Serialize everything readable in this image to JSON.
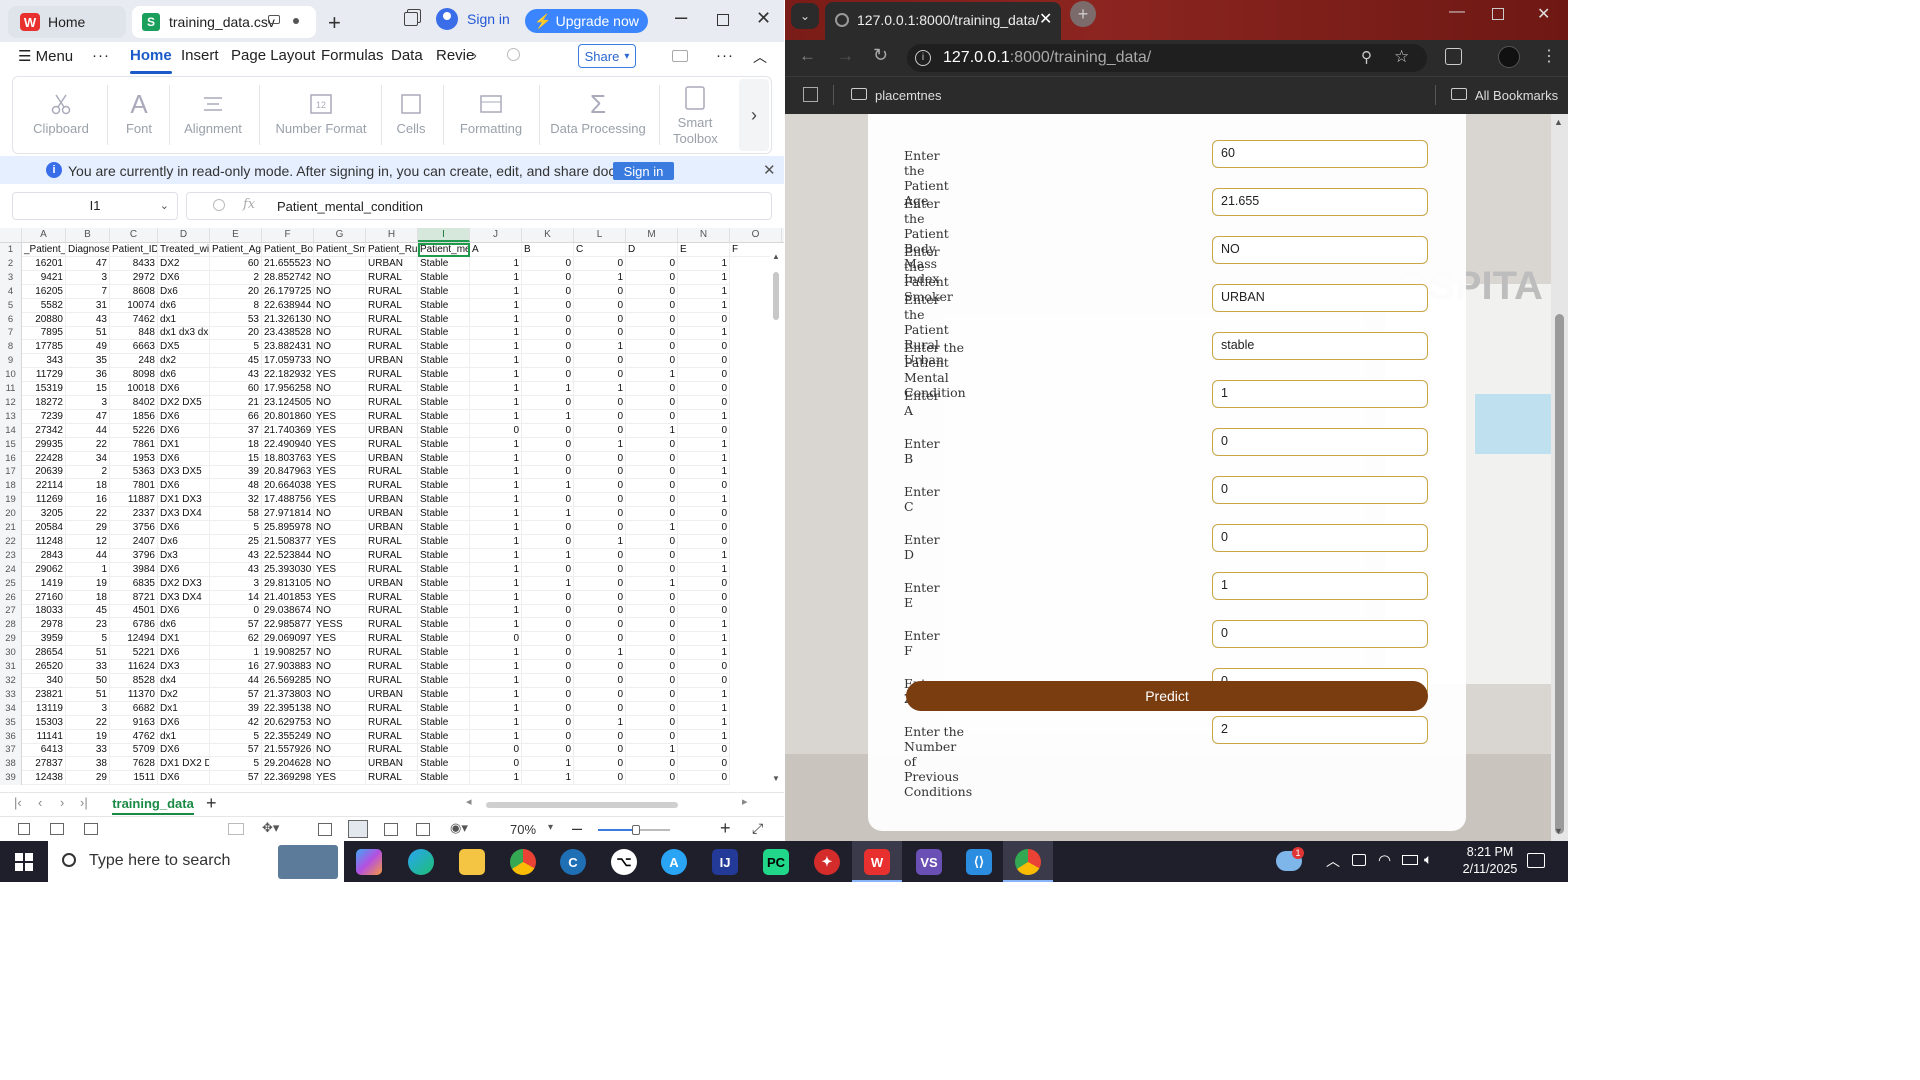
{
  "wps": {
    "home_tab": "Home",
    "file_tab": "training_data.csv",
    "sign_in": "Sign in",
    "upgrade": "Upgrade now",
    "menu": [
      "Menu",
      "Home",
      "Insert",
      "Page Layout",
      "Formulas",
      "Data",
      "Revie"
    ],
    "share": "Share",
    "ribbon": [
      "Clipboard",
      "Font",
      "Alignment",
      "Number Format",
      "Cells",
      "Formatting",
      "Data Processing",
      "Smart Toolbox"
    ],
    "banner_text": "You are currently in read-only mode. After signing in, you can create, edit, and share documents.",
    "banner_signin": "Sign in",
    "name_box": "I1",
    "formula_fx": "fx",
    "formula_value": "Patient_mental_condition",
    "columns": [
      "A",
      "B",
      "C",
      "D",
      "E",
      "F",
      "G",
      "H",
      "I",
      "J",
      "K",
      "L",
      "M",
      "N",
      "O"
    ],
    "header_row": [
      "_Patient_",
      "Diagnosed_",
      "Patient_ID",
      "Treated_wi",
      "Patient_Ag",
      "Patient_Bo",
      "Patient_Sm",
      "Patient_Ru",
      "Patient_me",
      "A",
      "B",
      "C",
      "D",
      "E",
      "F"
    ],
    "rows": [
      [
        "16201",
        "47",
        "8433",
        "DX2",
        "60",
        "21.655523",
        "NO",
        "URBAN",
        "Stable",
        "1",
        "0",
        "0",
        "0",
        "1"
      ],
      [
        "9421",
        "3",
        "2972",
        "DX6",
        "2",
        "28.852742",
        "NO",
        "RURAL",
        "Stable",
        "1",
        "0",
        "1",
        "0",
        "1"
      ],
      [
        "16205",
        "7",
        "8608",
        "Dx6",
        "20",
        "26.179725",
        "NO",
        "RURAL",
        "Stable",
        "1",
        "0",
        "0",
        "0",
        "1"
      ],
      [
        "5582",
        "31",
        "10074",
        "dx6",
        "8",
        "22.638944",
        "NO",
        "RURAL",
        "Stable",
        "1",
        "0",
        "0",
        "0",
        "1"
      ],
      [
        "20880",
        "43",
        "7462",
        "dx1",
        "53",
        "21.326130",
        "NO",
        "RURAL",
        "Stable",
        "1",
        "0",
        "0",
        "0",
        "0"
      ],
      [
        "7895",
        "51",
        "848",
        "dx1 dx3 dx",
        "20",
        "23.438528",
        "NO",
        "RURAL",
        "Stable",
        "1",
        "0",
        "0",
        "0",
        "1"
      ],
      [
        "17785",
        "49",
        "6663",
        "DX5",
        "5",
        "23.882431",
        "NO",
        "RURAL",
        "Stable",
        "1",
        "0",
        "1",
        "0",
        "0"
      ],
      [
        "343",
        "35",
        "248",
        "dx2",
        "45",
        "17.059733",
        "NO",
        "URBAN",
        "Stable",
        "1",
        "0",
        "0",
        "0",
        "0"
      ],
      [
        "11729",
        "36",
        "8098",
        "dx6",
        "43",
        "22.182932",
        "YES",
        "RURAL",
        "Stable",
        "1",
        "0",
        "0",
        "1",
        "0"
      ],
      [
        "15319",
        "15",
        "10018",
        "DX6",
        "60",
        "17.956258",
        "NO",
        "RURAL",
        "Stable",
        "1",
        "1",
        "1",
        "0",
        "0"
      ],
      [
        "18272",
        "3",
        "8402",
        "DX2 DX5",
        "21",
        "23.124505",
        "NO",
        "RURAL",
        "Stable",
        "1",
        "0",
        "0",
        "0",
        "0"
      ],
      [
        "7239",
        "47",
        "1856",
        "DX6",
        "66",
        "20.801860",
        "YES",
        "RURAL",
        "Stable",
        "1",
        "1",
        "0",
        "0",
        "1"
      ],
      [
        "27342",
        "44",
        "5226",
        "DX6",
        "37",
        "21.740369",
        "YES",
        "URBAN",
        "Stable",
        "0",
        "0",
        "0",
        "1",
        "0"
      ],
      [
        "29935",
        "22",
        "7861",
        "DX1",
        "18",
        "22.490940",
        "YES",
        "RURAL",
        "Stable",
        "1",
        "0",
        "1",
        "0",
        "1"
      ],
      [
        "22428",
        "34",
        "1953",
        "DX6",
        "15",
        "18.803763",
        "YES",
        "URBAN",
        "Stable",
        "1",
        "0",
        "0",
        "0",
        "1"
      ],
      [
        "20639",
        "2",
        "5363",
        "DX3 DX5",
        "39",
        "20.847963",
        "YES",
        "RURAL",
        "Stable",
        "1",
        "0",
        "0",
        "0",
        "1"
      ],
      [
        "22114",
        "18",
        "7801",
        "DX6",
        "48",
        "20.664038",
        "YES",
        "RURAL",
        "Stable",
        "1",
        "1",
        "0",
        "0",
        "0"
      ],
      [
        "11269",
        "16",
        "11887",
        "DX1 DX3",
        "32",
        "17.488756",
        "YES",
        "URBAN",
        "Stable",
        "1",
        "0",
        "0",
        "0",
        "1"
      ],
      [
        "3205",
        "22",
        "2337",
        "DX3 DX4",
        "58",
        "27.971814",
        "NO",
        "URBAN",
        "Stable",
        "1",
        "1",
        "0",
        "0",
        "0"
      ],
      [
        "20584",
        "29",
        "3756",
        "DX6",
        "5",
        "25.895978",
        "NO",
        "URBAN",
        "Stable",
        "1",
        "0",
        "0",
        "1",
        "0"
      ],
      [
        "11248",
        "12",
        "2407",
        "Dx6",
        "25",
        "21.508377",
        "YES",
        "RURAL",
        "Stable",
        "1",
        "0",
        "1",
        "0",
        "0"
      ],
      [
        "2843",
        "44",
        "3796",
        "Dx3",
        "43",
        "22.523844",
        "NO",
        "RURAL",
        "Stable",
        "1",
        "1",
        "0",
        "0",
        "1"
      ],
      [
        "29062",
        "1",
        "3984",
        "DX6",
        "43",
        "25.393030",
        "YES",
        "RURAL",
        "Stable",
        "1",
        "0",
        "0",
        "0",
        "1"
      ],
      [
        "1419",
        "19",
        "6835",
        "DX2 DX3",
        "3",
        "29.813105",
        "NO",
        "URBAN",
        "Stable",
        "1",
        "1",
        "0",
        "1",
        "0"
      ],
      [
        "27160",
        "18",
        "8721",
        "DX3 DX4",
        "14",
        "21.401853",
        "YES",
        "RURAL",
        "Stable",
        "1",
        "0",
        "0",
        "0",
        "0"
      ],
      [
        "18033",
        "45",
        "4501",
        "DX6",
        "0",
        "29.038674",
        "NO",
        "RURAL",
        "Stable",
        "1",
        "0",
        "0",
        "0",
        "0"
      ],
      [
        "2978",
        "23",
        "6786",
        "dx6",
        "57",
        "22.985877",
        "YESS",
        "RURAL",
        "Stable",
        "1",
        "0",
        "0",
        "0",
        "1"
      ],
      [
        "3959",
        "5",
        "12494",
        "DX1",
        "62",
        "29.069097",
        "YES",
        "RURAL",
        "Stable",
        "0",
        "0",
        "0",
        "0",
        "1"
      ],
      [
        "28654",
        "51",
        "5221",
        "DX6",
        "1",
        "19.908257",
        "NO",
        "RURAL",
        "Stable",
        "1",
        "0",
        "1",
        "0",
        "1"
      ],
      [
        "26520",
        "33",
        "11624",
        "DX3",
        "16",
        "27.903883",
        "NO",
        "RURAL",
        "Stable",
        "1",
        "0",
        "0",
        "0",
        "0"
      ],
      [
        "340",
        "50",
        "8528",
        "dx4",
        "44",
        "26.569285",
        "NO",
        "RURAL",
        "Stable",
        "1",
        "0",
        "0",
        "0",
        "0"
      ],
      [
        "23821",
        "51",
        "11370",
        "Dx2",
        "57",
        "21.373803",
        "NO",
        "URBAN",
        "Stable",
        "1",
        "0",
        "0",
        "0",
        "1"
      ],
      [
        "13119",
        "3",
        "6682",
        "Dx1",
        "39",
        "22.395138",
        "NO",
        "RURAL",
        "Stable",
        "1",
        "0",
        "0",
        "0",
        "1"
      ],
      [
        "15303",
        "22",
        "9163",
        "DX6",
        "42",
        "20.629753",
        "NO",
        "RURAL",
        "Stable",
        "1",
        "0",
        "1",
        "0",
        "1"
      ],
      [
        "11141",
        "19",
        "4762",
        "dx1",
        "5",
        "22.355249",
        "NO",
        "RURAL",
        "Stable",
        "1",
        "0",
        "0",
        "0",
        "1"
      ],
      [
        "6413",
        "33",
        "5709",
        "DX6",
        "57",
        "21.557926",
        "NO",
        "RURAL",
        "Stable",
        "0",
        "0",
        "0",
        "1",
        "0"
      ],
      [
        "27837",
        "38",
        "7628",
        "DX1 DX2 D",
        "5",
        "29.204628",
        "NO",
        "URBAN",
        "Stable",
        "0",
        "1",
        "0",
        "0",
        "0"
      ],
      [
        "12438",
        "29",
        "1511",
        "DX6",
        "57",
        "22.369298",
        "YES",
        "RURAL",
        "Stable",
        "1",
        "1",
        "0",
        "0",
        "0"
      ]
    ],
    "sheet_tab": "training_data",
    "zoom": "70%"
  },
  "browser": {
    "tab_title": "127.0.0.1:8000/training_data/",
    "url_host": "127.0.0.1",
    "url_path": ":8000/training_data/",
    "bookmark_folder": "placemtnes",
    "all_bookmarks": "All Bookmarks",
    "bg_text": "OSPITA",
    "fields": [
      {
        "label": "Enter the Patient Age",
        "value": "60"
      },
      {
        "label": "Enter the Patient Body Mass Index",
        "value": "21.655"
      },
      {
        "label": "Enter the Patient Smoker",
        "value": "NO"
      },
      {
        "label": "Enter the Patient Rural Urban",
        "value": "URBAN"
      },
      {
        "label": "Enter the Patient Mental Condition",
        "value": "stable"
      },
      {
        "label": "Enter A",
        "value": "1"
      },
      {
        "label": "Enter B",
        "value": "0"
      },
      {
        "label": "Enter C",
        "value": "0"
      },
      {
        "label": "Enter D",
        "value": "0"
      },
      {
        "label": "Enter E",
        "value": "1"
      },
      {
        "label": "Enter F",
        "value": "0"
      },
      {
        "label": "Enter Z",
        "value": "0"
      },
      {
        "label": "Enter the Number of Previous Conditions",
        "value": "2"
      }
    ],
    "predict": "Predict"
  },
  "taskbar": {
    "search": "Type here to search",
    "time": "8:21 PM",
    "date": "2/11/2025",
    "badge": "1"
  },
  "colors": {
    "accent": "#1b5ac8",
    "sheet_green": "#1b8a45",
    "predict": "#7a3d10",
    "input_border": "#c9a544"
  }
}
